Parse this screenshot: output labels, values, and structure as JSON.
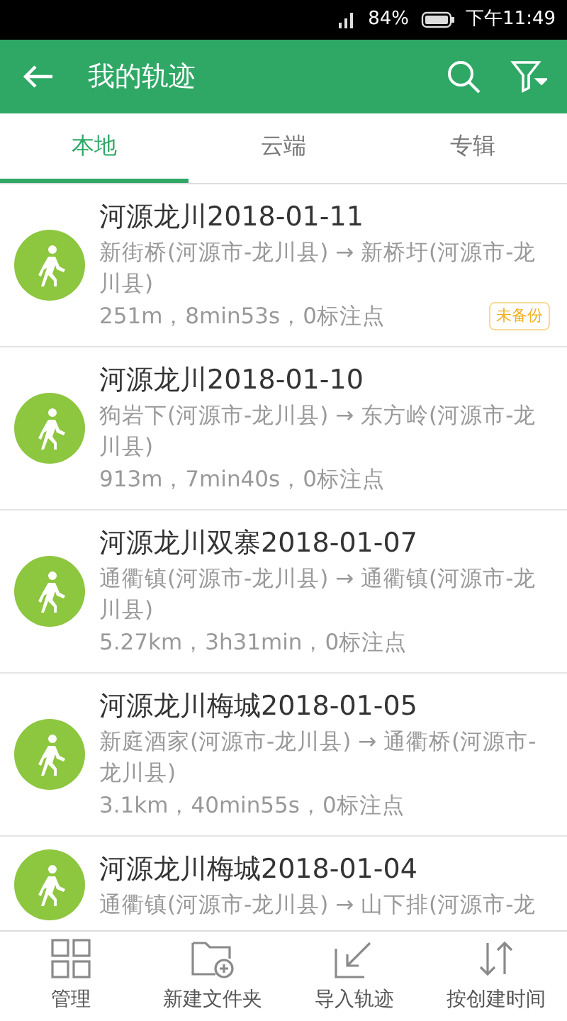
{
  "status_bar": {
    "battery": "84%",
    "time": "下午11:49"
  },
  "header": {
    "title": "我的轨迹"
  },
  "tabs": [
    {
      "label": "本地",
      "selected": true
    },
    {
      "label": "云端",
      "selected": false
    },
    {
      "label": "专辑",
      "selected": false
    }
  ],
  "tracks": [
    {
      "title": "河源龙川2018-01-11",
      "route": "新街桥(河源市-龙川县) → 新桥圩(河源市-龙川县)",
      "stats": "251m，8min53s，0标注点",
      "badge": "未备份"
    },
    {
      "title": "河源龙川2018-01-10",
      "route": "狗岩下(河源市-龙川县) → 东方岭(河源市-龙川县)",
      "stats": "913m，7min40s，0标注点"
    },
    {
      "title": "河源龙川双寨2018-01-07",
      "route": "通衢镇(河源市-龙川县) → 通衢镇(河源市-龙川县)",
      "stats": "5.27km，3h31min，0标注点"
    },
    {
      "title": "河源龙川梅城2018-01-05",
      "route": "新庭酒家(河源市-龙川县) → 通衢桥(河源市-龙川县)",
      "stats": "3.1km，40min55s，0标注点"
    },
    {
      "title": "河源龙川梅城2018-01-04",
      "route": "通衢镇(河源市-龙川县) → 山下排(河源市-龙"
    }
  ],
  "toolbar": [
    {
      "kind": "grid",
      "label": "管理"
    },
    {
      "kind": "folder",
      "label": "新建文件夹"
    },
    {
      "kind": "import",
      "label": "导入轨迹"
    },
    {
      "kind": "sort",
      "label": "按创建时间"
    }
  ]
}
